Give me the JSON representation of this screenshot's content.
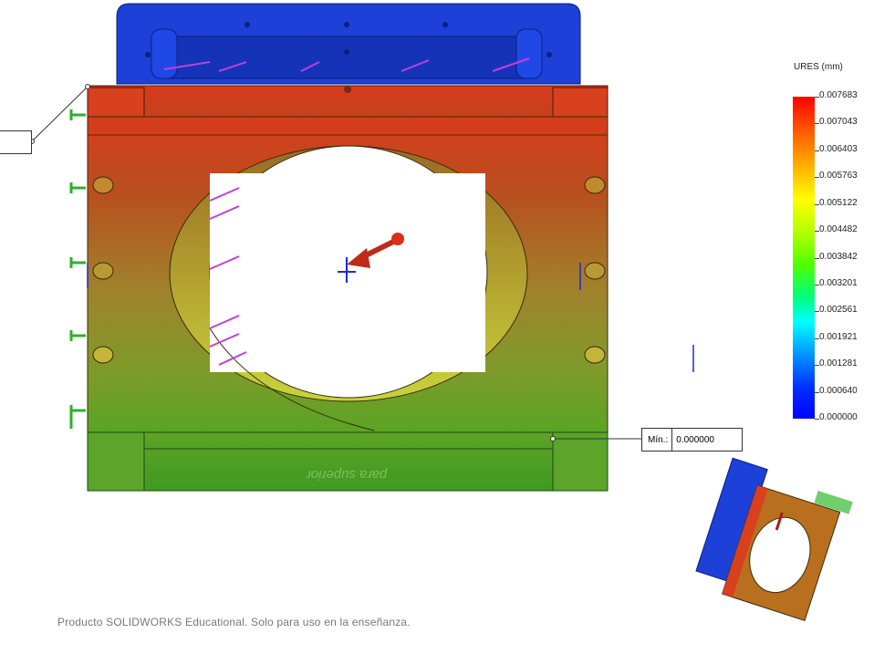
{
  "legend": {
    "title": "URES (mm)",
    "values": [
      "0.007683",
      "0.007043",
      "0.006403",
      "0.005763",
      "0.005122",
      "0.004482",
      "0.003842",
      "0.003201",
      "0.002561",
      "0.001921",
      "0.001281",
      "0.000640",
      "0.000000"
    ]
  },
  "min_callout": {
    "label": "Mín.:",
    "value": "0.000000"
  },
  "part_text": "para superior",
  "footer": "Producto SOLIDWORKS Educational. Solo para uso en la enseñanza.",
  "colors": {
    "plate_top": "#d23a1e",
    "plate_mid": "#b86a2a",
    "plate_bottom": "#4a9e22",
    "frame_blue": "#1b3fd6",
    "load_magenta": "#c243d6",
    "fixture_green": "#3fb83a"
  }
}
